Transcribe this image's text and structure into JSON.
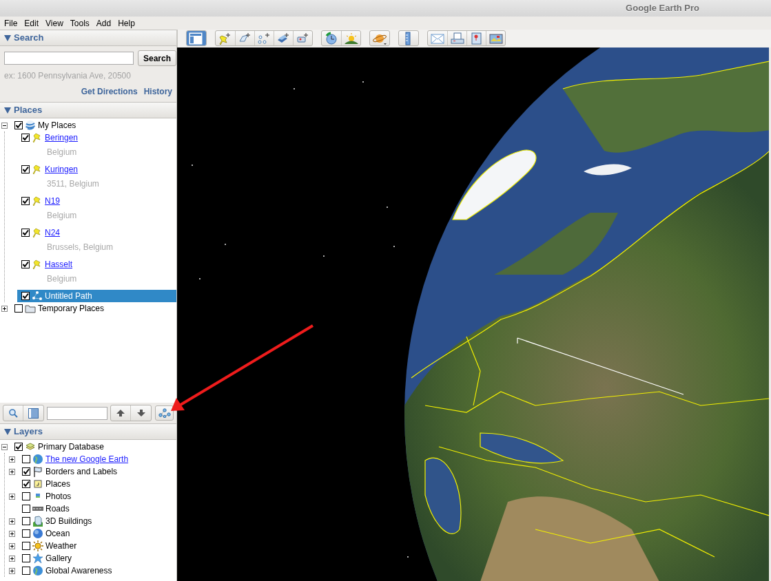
{
  "window": {
    "title": "Google Earth Pro"
  },
  "menu": [
    "File",
    "Edit",
    "View",
    "Tools",
    "Add",
    "Help"
  ],
  "search": {
    "header": "Search",
    "expanded": true,
    "button": "Search",
    "hint": "ex: 1600 Pennsylvania Ave, 20500",
    "links": [
      "Get Directions",
      "History"
    ]
  },
  "places": {
    "header": "Places",
    "expanded": true,
    "tree": [
      {
        "label": "My Places",
        "kind": "globe",
        "checked": true,
        "expanded": true,
        "selected": false,
        "children": [
          {
            "label": "Beringen",
            "subtitle": "Belgium",
            "kind": "placemark",
            "checked": true,
            "selected": false
          },
          {
            "label": "Kuringen",
            "subtitle": "3511, Belgium",
            "kind": "placemark",
            "checked": true,
            "selected": false
          },
          {
            "label": "N19",
            "subtitle": "Belgium",
            "kind": "placemark",
            "checked": true,
            "selected": false
          },
          {
            "label": "N24",
            "subtitle": "Brussels, Belgium",
            "kind": "placemark",
            "checked": true,
            "selected": false
          },
          {
            "label": "Hasselt",
            "subtitle": "Belgium",
            "kind": "placemark",
            "checked": true,
            "selected": false
          },
          {
            "label": "Untitled Path",
            "kind": "path",
            "checked": true,
            "selected": true
          }
        ]
      },
      {
        "label": "Temporary Places",
        "kind": "folder",
        "checked": false,
        "expanded": false,
        "selected": false
      }
    ]
  },
  "layers": {
    "header": "Layers",
    "expanded": true,
    "tree": [
      {
        "label": "Primary Database",
        "kind": "database",
        "checked": true,
        "expanded": true,
        "children": [
          {
            "label": "The new Google Earth",
            "kind": "earth",
            "checked": false,
            "expanded": false,
            "link": true
          },
          {
            "label": "Borders and Labels",
            "kind": "flag",
            "checked": true,
            "expanded": false
          },
          {
            "label": "Places",
            "kind": "places",
            "checked": true
          },
          {
            "label": "Photos",
            "kind": "photo",
            "checked": false,
            "expanded": false
          },
          {
            "label": "Roads",
            "kind": "road",
            "checked": false
          },
          {
            "label": "3D Buildings",
            "kind": "building",
            "checked": false,
            "expanded": false
          },
          {
            "label": "Ocean",
            "kind": "ocean",
            "checked": false,
            "expanded": false
          },
          {
            "label": "Weather",
            "kind": "sun",
            "checked": false,
            "expanded": false
          },
          {
            "label": "Gallery",
            "kind": "star",
            "checked": false,
            "expanded": false
          },
          {
            "label": "Global Awareness",
            "kind": "earth",
            "checked": false,
            "expanded": false
          }
        ]
      }
    ]
  },
  "toolbar": [
    [
      {
        "kind": "sidebar",
        "selected": true
      }
    ],
    [
      {
        "kind": "placemark",
        "selected": false
      },
      {
        "kind": "polygon",
        "selected": false
      },
      {
        "kind": "path",
        "selected": false
      },
      {
        "kind": "overlay",
        "selected": false
      },
      {
        "kind": "tour",
        "selected": false
      }
    ],
    [
      {
        "kind": "history",
        "selected": false
      },
      {
        "kind": "sunlight",
        "selected": false
      }
    ],
    [
      {
        "kind": "planet",
        "selected": false
      }
    ],
    [
      {
        "kind": "ruler",
        "selected": false
      }
    ],
    [
      {
        "kind": "email",
        "selected": false
      },
      {
        "kind": "print",
        "selected": false
      },
      {
        "kind": "maps",
        "selected": false
      },
      {
        "kind": "image",
        "selected": false
      }
    ]
  ]
}
